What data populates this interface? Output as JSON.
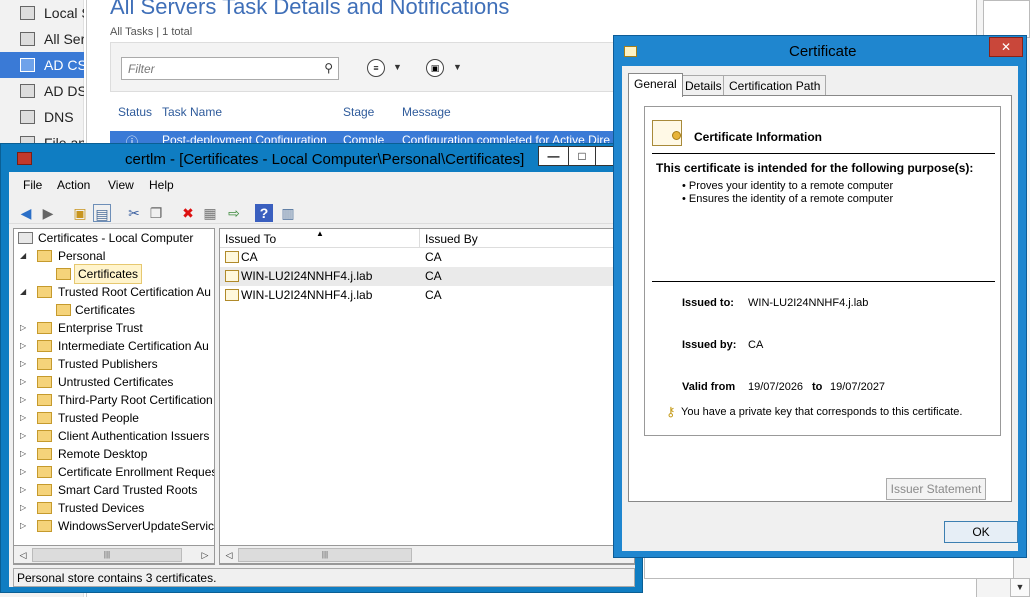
{
  "server_manager": {
    "nav_items": [
      "Local S",
      "All Ser",
      "AD CS",
      "AD DS",
      "DNS",
      "File an"
    ],
    "title": "All Servers Task Details and Notifications",
    "subtitle": "All Tasks | 1 total",
    "filter_placeholder": "Filter",
    "columns": [
      "Status",
      "Task Name",
      "Stage",
      "Message"
    ],
    "row": {
      "status_icon": "info-icon",
      "task_name": "Post-deployment Configuration",
      "stage": "Comple",
      "message": "Configuration completed for Active Dire"
    }
  },
  "certlm": {
    "title": "certlm - [Certificates - Local Computer\\Personal\\Certificates]",
    "menu": [
      "File",
      "Action",
      "View",
      "Help"
    ],
    "tree": [
      {
        "label": "Certificates - Local Computer",
        "level": 0,
        "twisty": ""
      },
      {
        "label": "Personal",
        "level": 1,
        "twisty": "◢"
      },
      {
        "label": "Certificates",
        "level": 2,
        "twisty": ""
      },
      {
        "label": "Trusted Root Certification Au",
        "level": 1,
        "twisty": "◢"
      },
      {
        "label": "Certificates",
        "level": 2,
        "twisty": ""
      },
      {
        "label": "Enterprise Trust",
        "level": 1,
        "twisty": "▷"
      },
      {
        "label": "Intermediate Certification Au",
        "level": 1,
        "twisty": "▷"
      },
      {
        "label": "Trusted Publishers",
        "level": 1,
        "twisty": "▷"
      },
      {
        "label": "Untrusted Certificates",
        "level": 1,
        "twisty": "▷"
      },
      {
        "label": "Third-Party Root Certification",
        "level": 1,
        "twisty": "▷"
      },
      {
        "label": "Trusted People",
        "level": 1,
        "twisty": "▷"
      },
      {
        "label": "Client Authentication Issuers",
        "level": 1,
        "twisty": "▷"
      },
      {
        "label": "Remote Desktop",
        "level": 1,
        "twisty": "▷"
      },
      {
        "label": "Certificate Enrollment Reques",
        "level": 1,
        "twisty": "▷"
      },
      {
        "label": "Smart Card Trusted Roots",
        "level": 1,
        "twisty": "▷"
      },
      {
        "label": "Trusted Devices",
        "level": 1,
        "twisty": "▷"
      },
      {
        "label": "WindowsServerUpdateServices",
        "level": 1,
        "twisty": "▷"
      }
    ],
    "list_columns": [
      "Issued To",
      "Issued By"
    ],
    "list_rows": [
      {
        "issued_to": "CA",
        "issued_by": "CA"
      },
      {
        "issued_to": "WIN-LU2I24NNHF4.j.lab",
        "issued_by": "CA"
      },
      {
        "issued_to": "WIN-LU2I24NNHF4.j.lab",
        "issued_by": "CA"
      }
    ],
    "status": "Personal store contains 3 certificates."
  },
  "certificate_dialog": {
    "title": "Certificate",
    "tabs": [
      "General",
      "Details",
      "Certification Path"
    ],
    "info_title": "Certificate Information",
    "purpose_title": "This certificate is intended for the following purpose(s):",
    "purposes": [
      "• Proves your identity to a remote computer",
      "• Ensures the identity of a remote computer"
    ],
    "issued_to_label": "Issued to:",
    "issued_to": "WIN-LU2I24NNHF4.j.lab",
    "issued_by_label": "Issued by:",
    "issued_by": "CA",
    "valid_from_label": "Valid from",
    "valid_from": "19/07/2026",
    "valid_to_label": "to",
    "valid_to": "19/07/2027",
    "private_key_note": "You have a private key that corresponds to this certificate.",
    "issuer_statement_label": "Issuer Statement",
    "ok_label": "OK"
  }
}
